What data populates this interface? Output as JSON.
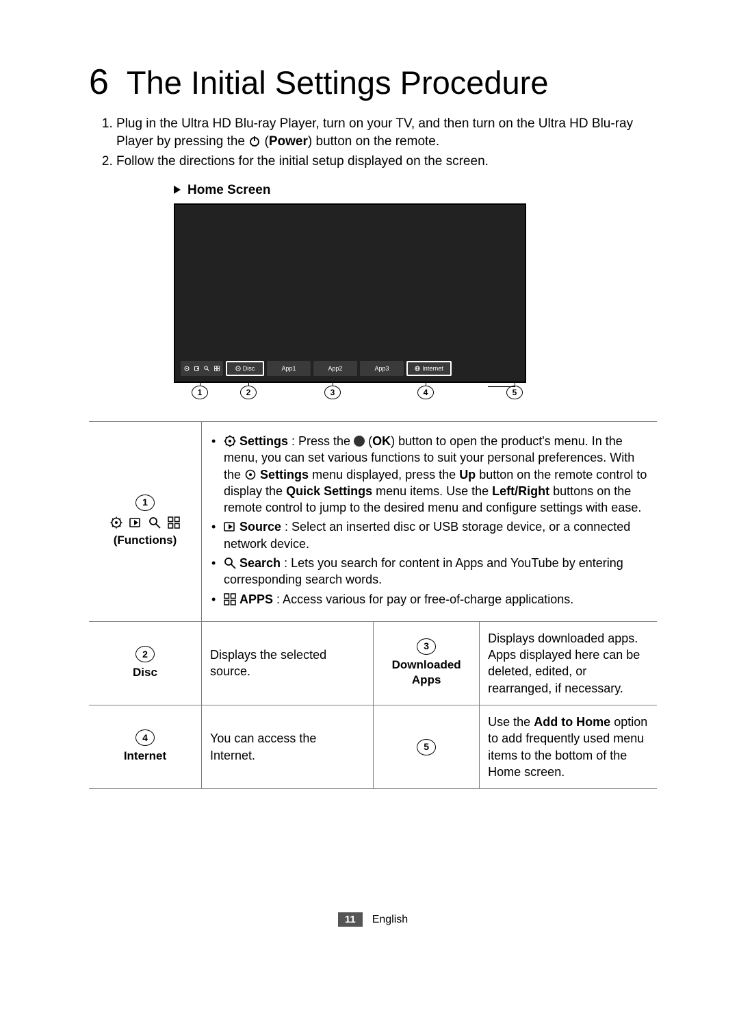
{
  "chapter": {
    "number": "6",
    "title": "The Initial Settings Procedure"
  },
  "steps": {
    "s1a": "Plug in the Ultra HD Blu-ray Player, turn on your TV, and then turn on the Ultra HD Blu-ray Player by pressing the ",
    "s1b_power": "Power",
    "s1c": ") button on the remote.",
    "s2": "Follow the directions for the initial setup displayed on the screen."
  },
  "home_screen_label": "Home Screen",
  "tiles": {
    "disc": "Disc",
    "app1": "App1",
    "app2": "App2",
    "app3": "App3",
    "internet": "Internet"
  },
  "callout_nums": {
    "n1": "1",
    "n2": "2",
    "n3": "3",
    "n4": "4",
    "n5": "5"
  },
  "row1": {
    "label": "(Functions)",
    "num": "1",
    "settings_b": "Settings",
    "settings_txt_a": " : Press the ",
    "ok": "OK",
    "settings_txt_b": ") button to open the product's menu. In the menu, you can set various functions to suit your personal preferences. With the ",
    "settings_txt_c": " menu displayed, press the ",
    "up": "Up",
    "settings_txt_d": " button on the remote control to display the ",
    "quick": "Quick Settings",
    "settings_txt_e": " menu items. Use the ",
    "lr": "Left/Right",
    "settings_txt_f": " buttons on the remote control to jump to the desired menu and configure settings with ease.",
    "source_b": "Source",
    "source_txt": " : Select an inserted disc or USB storage device, or a connected network device.",
    "search_b": "Search",
    "search_txt": " : Lets you search for content in Apps and YouTube by entering corresponding search words.",
    "apps_b": "APPS",
    "apps_txt": " : Access various for pay or free-of-charge applications."
  },
  "row2": {
    "num": "2",
    "label": "Disc",
    "txtL": "Displays the selected source.",
    "midnum": "3",
    "midlabel": "Downloaded Apps",
    "txtR": "Displays downloaded apps. Apps displayed here can be deleted, edited, or rearranged, if necessary."
  },
  "row3": {
    "num": "4",
    "label": "Internet",
    "txtL": "You can access the Internet.",
    "midnum": "5",
    "txtR_a": "Use the ",
    "addhome": "Add to Home",
    "txtR_b": " option to add frequently used menu items to the bottom of the Home screen."
  },
  "footer": {
    "page": "11",
    "lang": "English"
  }
}
